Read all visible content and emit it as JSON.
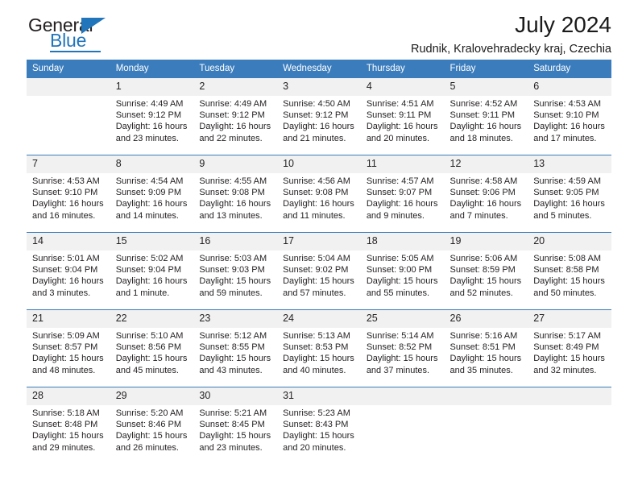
{
  "logo": {
    "primary_text": "General",
    "secondary_text": "Blue",
    "accent_color": "#2175bb"
  },
  "header": {
    "month_title": "July 2024",
    "location": "Rudnik, Kralovehradecky kraj, Czechia"
  },
  "calendar": {
    "header_bg": "#3b7cbc",
    "daynum_bg": "#f1f1f1",
    "weekday_headers": [
      "Sunday",
      "Monday",
      "Tuesday",
      "Wednesday",
      "Thursday",
      "Friday",
      "Saturday"
    ],
    "weeks": [
      [
        {
          "day": "",
          "lines": []
        },
        {
          "day": "1",
          "lines": [
            "Sunrise: 4:49 AM",
            "Sunset: 9:12 PM",
            "Daylight: 16 hours",
            "and 23 minutes."
          ]
        },
        {
          "day": "2",
          "lines": [
            "Sunrise: 4:49 AM",
            "Sunset: 9:12 PM",
            "Daylight: 16 hours",
            "and 22 minutes."
          ]
        },
        {
          "day": "3",
          "lines": [
            "Sunrise: 4:50 AM",
            "Sunset: 9:12 PM",
            "Daylight: 16 hours",
            "and 21 minutes."
          ]
        },
        {
          "day": "4",
          "lines": [
            "Sunrise: 4:51 AM",
            "Sunset: 9:11 PM",
            "Daylight: 16 hours",
            "and 20 minutes."
          ]
        },
        {
          "day": "5",
          "lines": [
            "Sunrise: 4:52 AM",
            "Sunset: 9:11 PM",
            "Daylight: 16 hours",
            "and 18 minutes."
          ]
        },
        {
          "day": "6",
          "lines": [
            "Sunrise: 4:53 AM",
            "Sunset: 9:10 PM",
            "Daylight: 16 hours",
            "and 17 minutes."
          ]
        }
      ],
      [
        {
          "day": "7",
          "lines": [
            "Sunrise: 4:53 AM",
            "Sunset: 9:10 PM",
            "Daylight: 16 hours",
            "and 16 minutes."
          ]
        },
        {
          "day": "8",
          "lines": [
            "Sunrise: 4:54 AM",
            "Sunset: 9:09 PM",
            "Daylight: 16 hours",
            "and 14 minutes."
          ]
        },
        {
          "day": "9",
          "lines": [
            "Sunrise: 4:55 AM",
            "Sunset: 9:08 PM",
            "Daylight: 16 hours",
            "and 13 minutes."
          ]
        },
        {
          "day": "10",
          "lines": [
            "Sunrise: 4:56 AM",
            "Sunset: 9:08 PM",
            "Daylight: 16 hours",
            "and 11 minutes."
          ]
        },
        {
          "day": "11",
          "lines": [
            "Sunrise: 4:57 AM",
            "Sunset: 9:07 PM",
            "Daylight: 16 hours",
            "and 9 minutes."
          ]
        },
        {
          "day": "12",
          "lines": [
            "Sunrise: 4:58 AM",
            "Sunset: 9:06 PM",
            "Daylight: 16 hours",
            "and 7 minutes."
          ]
        },
        {
          "day": "13",
          "lines": [
            "Sunrise: 4:59 AM",
            "Sunset: 9:05 PM",
            "Daylight: 16 hours",
            "and 5 minutes."
          ]
        }
      ],
      [
        {
          "day": "14",
          "lines": [
            "Sunrise: 5:01 AM",
            "Sunset: 9:04 PM",
            "Daylight: 16 hours",
            "and 3 minutes."
          ]
        },
        {
          "day": "15",
          "lines": [
            "Sunrise: 5:02 AM",
            "Sunset: 9:04 PM",
            "Daylight: 16 hours",
            "and 1 minute."
          ]
        },
        {
          "day": "16",
          "lines": [
            "Sunrise: 5:03 AM",
            "Sunset: 9:03 PM",
            "Daylight: 15 hours",
            "and 59 minutes."
          ]
        },
        {
          "day": "17",
          "lines": [
            "Sunrise: 5:04 AM",
            "Sunset: 9:02 PM",
            "Daylight: 15 hours",
            "and 57 minutes."
          ]
        },
        {
          "day": "18",
          "lines": [
            "Sunrise: 5:05 AM",
            "Sunset: 9:00 PM",
            "Daylight: 15 hours",
            "and 55 minutes."
          ]
        },
        {
          "day": "19",
          "lines": [
            "Sunrise: 5:06 AM",
            "Sunset: 8:59 PM",
            "Daylight: 15 hours",
            "and 52 minutes."
          ]
        },
        {
          "day": "20",
          "lines": [
            "Sunrise: 5:08 AM",
            "Sunset: 8:58 PM",
            "Daylight: 15 hours",
            "and 50 minutes."
          ]
        }
      ],
      [
        {
          "day": "21",
          "lines": [
            "Sunrise: 5:09 AM",
            "Sunset: 8:57 PM",
            "Daylight: 15 hours",
            "and 48 minutes."
          ]
        },
        {
          "day": "22",
          "lines": [
            "Sunrise: 5:10 AM",
            "Sunset: 8:56 PM",
            "Daylight: 15 hours",
            "and 45 minutes."
          ]
        },
        {
          "day": "23",
          "lines": [
            "Sunrise: 5:12 AM",
            "Sunset: 8:55 PM",
            "Daylight: 15 hours",
            "and 43 minutes."
          ]
        },
        {
          "day": "24",
          "lines": [
            "Sunrise: 5:13 AM",
            "Sunset: 8:53 PM",
            "Daylight: 15 hours",
            "and 40 minutes."
          ]
        },
        {
          "day": "25",
          "lines": [
            "Sunrise: 5:14 AM",
            "Sunset: 8:52 PM",
            "Daylight: 15 hours",
            "and 37 minutes."
          ]
        },
        {
          "day": "26",
          "lines": [
            "Sunrise: 5:16 AM",
            "Sunset: 8:51 PM",
            "Daylight: 15 hours",
            "and 35 minutes."
          ]
        },
        {
          "day": "27",
          "lines": [
            "Sunrise: 5:17 AM",
            "Sunset: 8:49 PM",
            "Daylight: 15 hours",
            "and 32 minutes."
          ]
        }
      ],
      [
        {
          "day": "28",
          "lines": [
            "Sunrise: 5:18 AM",
            "Sunset: 8:48 PM",
            "Daylight: 15 hours",
            "and 29 minutes."
          ]
        },
        {
          "day": "29",
          "lines": [
            "Sunrise: 5:20 AM",
            "Sunset: 8:46 PM",
            "Daylight: 15 hours",
            "and 26 minutes."
          ]
        },
        {
          "day": "30",
          "lines": [
            "Sunrise: 5:21 AM",
            "Sunset: 8:45 PM",
            "Daylight: 15 hours",
            "and 23 minutes."
          ]
        },
        {
          "day": "31",
          "lines": [
            "Sunrise: 5:23 AM",
            "Sunset: 8:43 PM",
            "Daylight: 15 hours",
            "and 20 minutes."
          ]
        },
        {
          "day": "",
          "lines": []
        },
        {
          "day": "",
          "lines": []
        },
        {
          "day": "",
          "lines": []
        }
      ]
    ]
  }
}
